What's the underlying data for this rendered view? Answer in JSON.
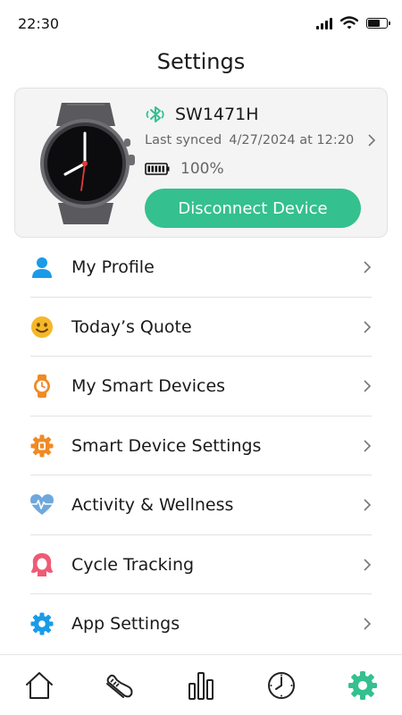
{
  "status_bar": {
    "time": "22:30",
    "icons": [
      "signal-icon",
      "wifi-icon",
      "battery-icon"
    ]
  },
  "page": {
    "title": "Settings"
  },
  "device": {
    "name": "SW1471H",
    "last_synced_label": "Last synced",
    "last_synced_value": "4/27/2024 at 12:20",
    "battery_percent": "100%",
    "battery_level": 1.0,
    "disconnect_label": "Disconnect Device",
    "connection_icon": "bluetooth-icon",
    "image": "smartwatch-image"
  },
  "menu": [
    {
      "label": "My Profile",
      "icon": "profile-icon"
    },
    {
      "label": "Today’s Quote",
      "icon": "smiley-icon"
    },
    {
      "label": "My Smart Devices",
      "icon": "watch-icon"
    },
    {
      "label": "Smart Device Settings",
      "icon": "device-gear-icon"
    },
    {
      "label": "Activity & Wellness",
      "icon": "heart-pulse-icon"
    },
    {
      "label": "Cycle Tracking",
      "icon": "cycle-icon"
    },
    {
      "label": "App Settings",
      "icon": "settings-gear-icon"
    }
  ],
  "bottom_nav": [
    {
      "name": "home",
      "icon": "home-icon",
      "active": false
    },
    {
      "name": "activity",
      "icon": "shoe-icon",
      "active": false
    },
    {
      "name": "stats",
      "icon": "bar-chart-icon",
      "active": false
    },
    {
      "name": "history",
      "icon": "clock-icon",
      "active": false
    },
    {
      "name": "settings",
      "icon": "gear-icon",
      "active": true
    }
  ],
  "colors": {
    "accent_green": "#34c08f",
    "icon_blue": "#1a9be8",
    "icon_yellow": "#f5b72a",
    "icon_orange": "#f08a24",
    "icon_pink": "#ef5a74",
    "card_bg": "#f4f4f4"
  }
}
